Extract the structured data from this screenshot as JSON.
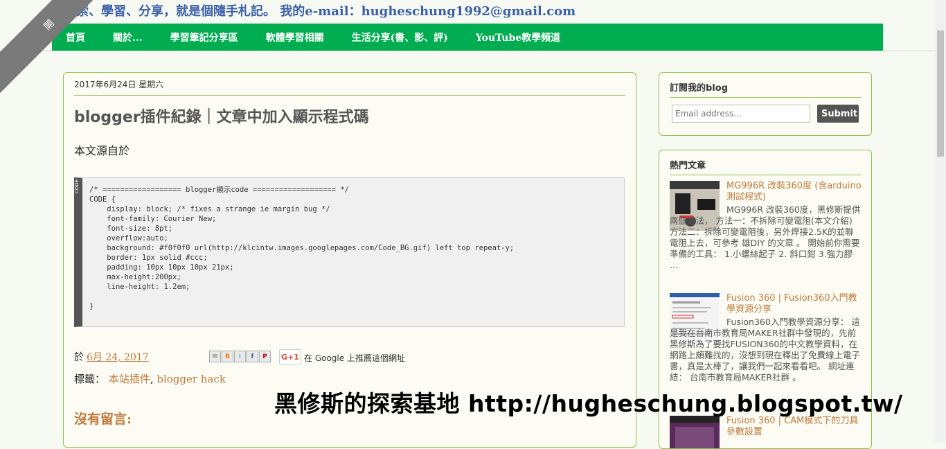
{
  "header": {
    "corner_ribbon": "開",
    "tagline": "探索、學習、分享，就是個隨手札記。 我的e-mail：hugheschung1992@gmail.com"
  },
  "nav": {
    "items": [
      "首頁",
      "關於...",
      "學習筆記分享區",
      "軟體學習相關",
      "生活分享(書、影、評)",
      "YouTube教學頻道"
    ]
  },
  "post": {
    "date_header": "2017年6月24日 星期六",
    "title": "blogger插件紀錄｜文章中加入顯示程式碼",
    "source_text": "本文源自於",
    "code_label": "CODE",
    "code": "/* ================== blogger顯示code =================== */\nCODE {\n    display: block; /* fixes a strange ie margin bug */\n    font-family: Courier New;\n    font-size: 8pt;\n    overflow:auto;\n    background: #f0f0f0 url(http://klcintw.images.googlepages.com/Code_BG.gif) left top repeat-y;\n    border: 1px solid #ccc;\n    padding: 10px 10px 10px 21px;\n    max-height:200px;\n    line-height: 1.2em;\n\n}",
    "footer_prefix": "於",
    "footer_date": "6月 24, 2017",
    "share_icons": [
      "email-icon",
      "blogger-icon",
      "twitter-icon",
      "facebook-icon",
      "pinterest-icon"
    ],
    "gplus_label": "G+1",
    "gplus_text": "在 Google 上推薦這個網址",
    "labels_prefix": "標籤：",
    "labels": [
      "本站插件",
      "blogger hack"
    ],
    "label_separator": ",",
    "no_comments": "沒有留言:"
  },
  "sidebar": {
    "subscribe": {
      "title": "訂閱我的blog",
      "placeholder": "Email address...",
      "submit_label": "Submit"
    },
    "popular": {
      "title": "熱門文章",
      "items": [
        {
          "title": "MG996R 改裝360度 (含arduino測試程式)",
          "snippet": "MG996R 改裝360度，黑修斯提供兩個方法， 方法一：不拆除可變電阻(本文介紹) 方法二：拆除可變電阻後，另外焊接2.5K的並聯電阻上去，可參考 雄DIY 的文章 。 開始前你需要準備的工具： 1.小螺絲起子 2. 斜口鉗 3.強力膠 ..."
        },
        {
          "title": "Fusion 360 | Fusion360入門教學資源分享",
          "snippet": "Fusion360入門教學資源分享： 這是我在台南市教育局MAKER社群中發現的，先前黑修斯為了要找FUSION360的中文教學資料，在網路上頗難找的，沒想到現在釋出了免費線上電子書，真是太棒了，讓我們一起來看看吧。 網址連結： 台南市教育局MAKER社群 。"
        },
        {
          "title": "Fusion 360 | CAM模式下的刀具參數設置",
          "snippet": ""
        }
      ]
    }
  },
  "watermark": "黑修斯的探索基地 http://hugheschung.blogspot.tw/"
}
